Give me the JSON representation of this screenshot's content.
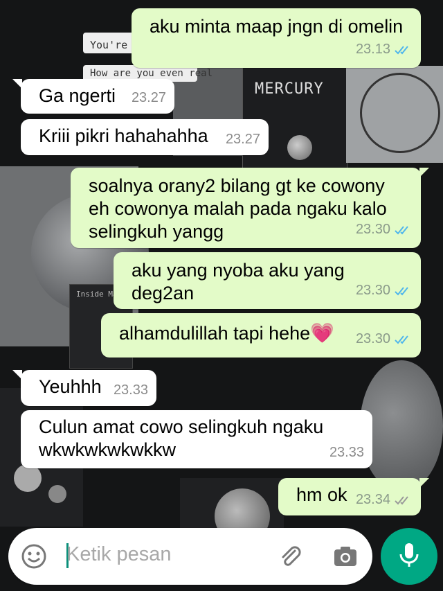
{
  "chat": {
    "messages": [
      {
        "dir": "out",
        "text": "aku minta maap jngn di omelin",
        "time": "23.13",
        "status": "read"
      },
      {
        "dir": "in",
        "text": "Ga ngerti",
        "time": "23.27"
      },
      {
        "dir": "in",
        "text": "Kriii pikri hahahahha",
        "time": "23.27"
      },
      {
        "dir": "out",
        "text": "soalnya orany2 bilang gt ke cowony eh cowonya malah pada ngaku kalo selingkuh yangg",
        "time": "23.30",
        "status": "read"
      },
      {
        "dir": "out",
        "text": "aku yang nyoba aku yang deg2an",
        "time": "23.30",
        "status": "read"
      },
      {
        "dir": "out",
        "text": "alhamdulillah tapi hehe",
        "emoji": "💗",
        "time": "23.30",
        "status": "read"
      },
      {
        "dir": "in",
        "text": "Yeuhhh",
        "time": "23.33"
      },
      {
        "dir": "in",
        "text": "Culun amat cowo selingkuh ngaku wkwkwkwkwkkw",
        "time": "23.33"
      },
      {
        "dir": "out",
        "text": "hm ok",
        "time": "23.34",
        "status": "delivered"
      }
    ]
  },
  "composer": {
    "placeholder": "Ketik pesan",
    "emoji_icon": "emoji-icon",
    "attach_icon": "paperclip-icon",
    "camera_icon": "camera-icon",
    "mic_icon": "mic-icon"
  },
  "wallpaper": {
    "labels": [
      "MERCURY",
      "You're so",
      "How are you even real",
      "MERCURY",
      "Inside Ma"
    ]
  },
  "colors": {
    "incoming_bubble": "#ffffff",
    "outgoing_bubble": "#e3fbc8",
    "read_tick": "#4fb6ec",
    "delivered_tick": "#9a9a9a",
    "mic_button": "#00a884"
  }
}
